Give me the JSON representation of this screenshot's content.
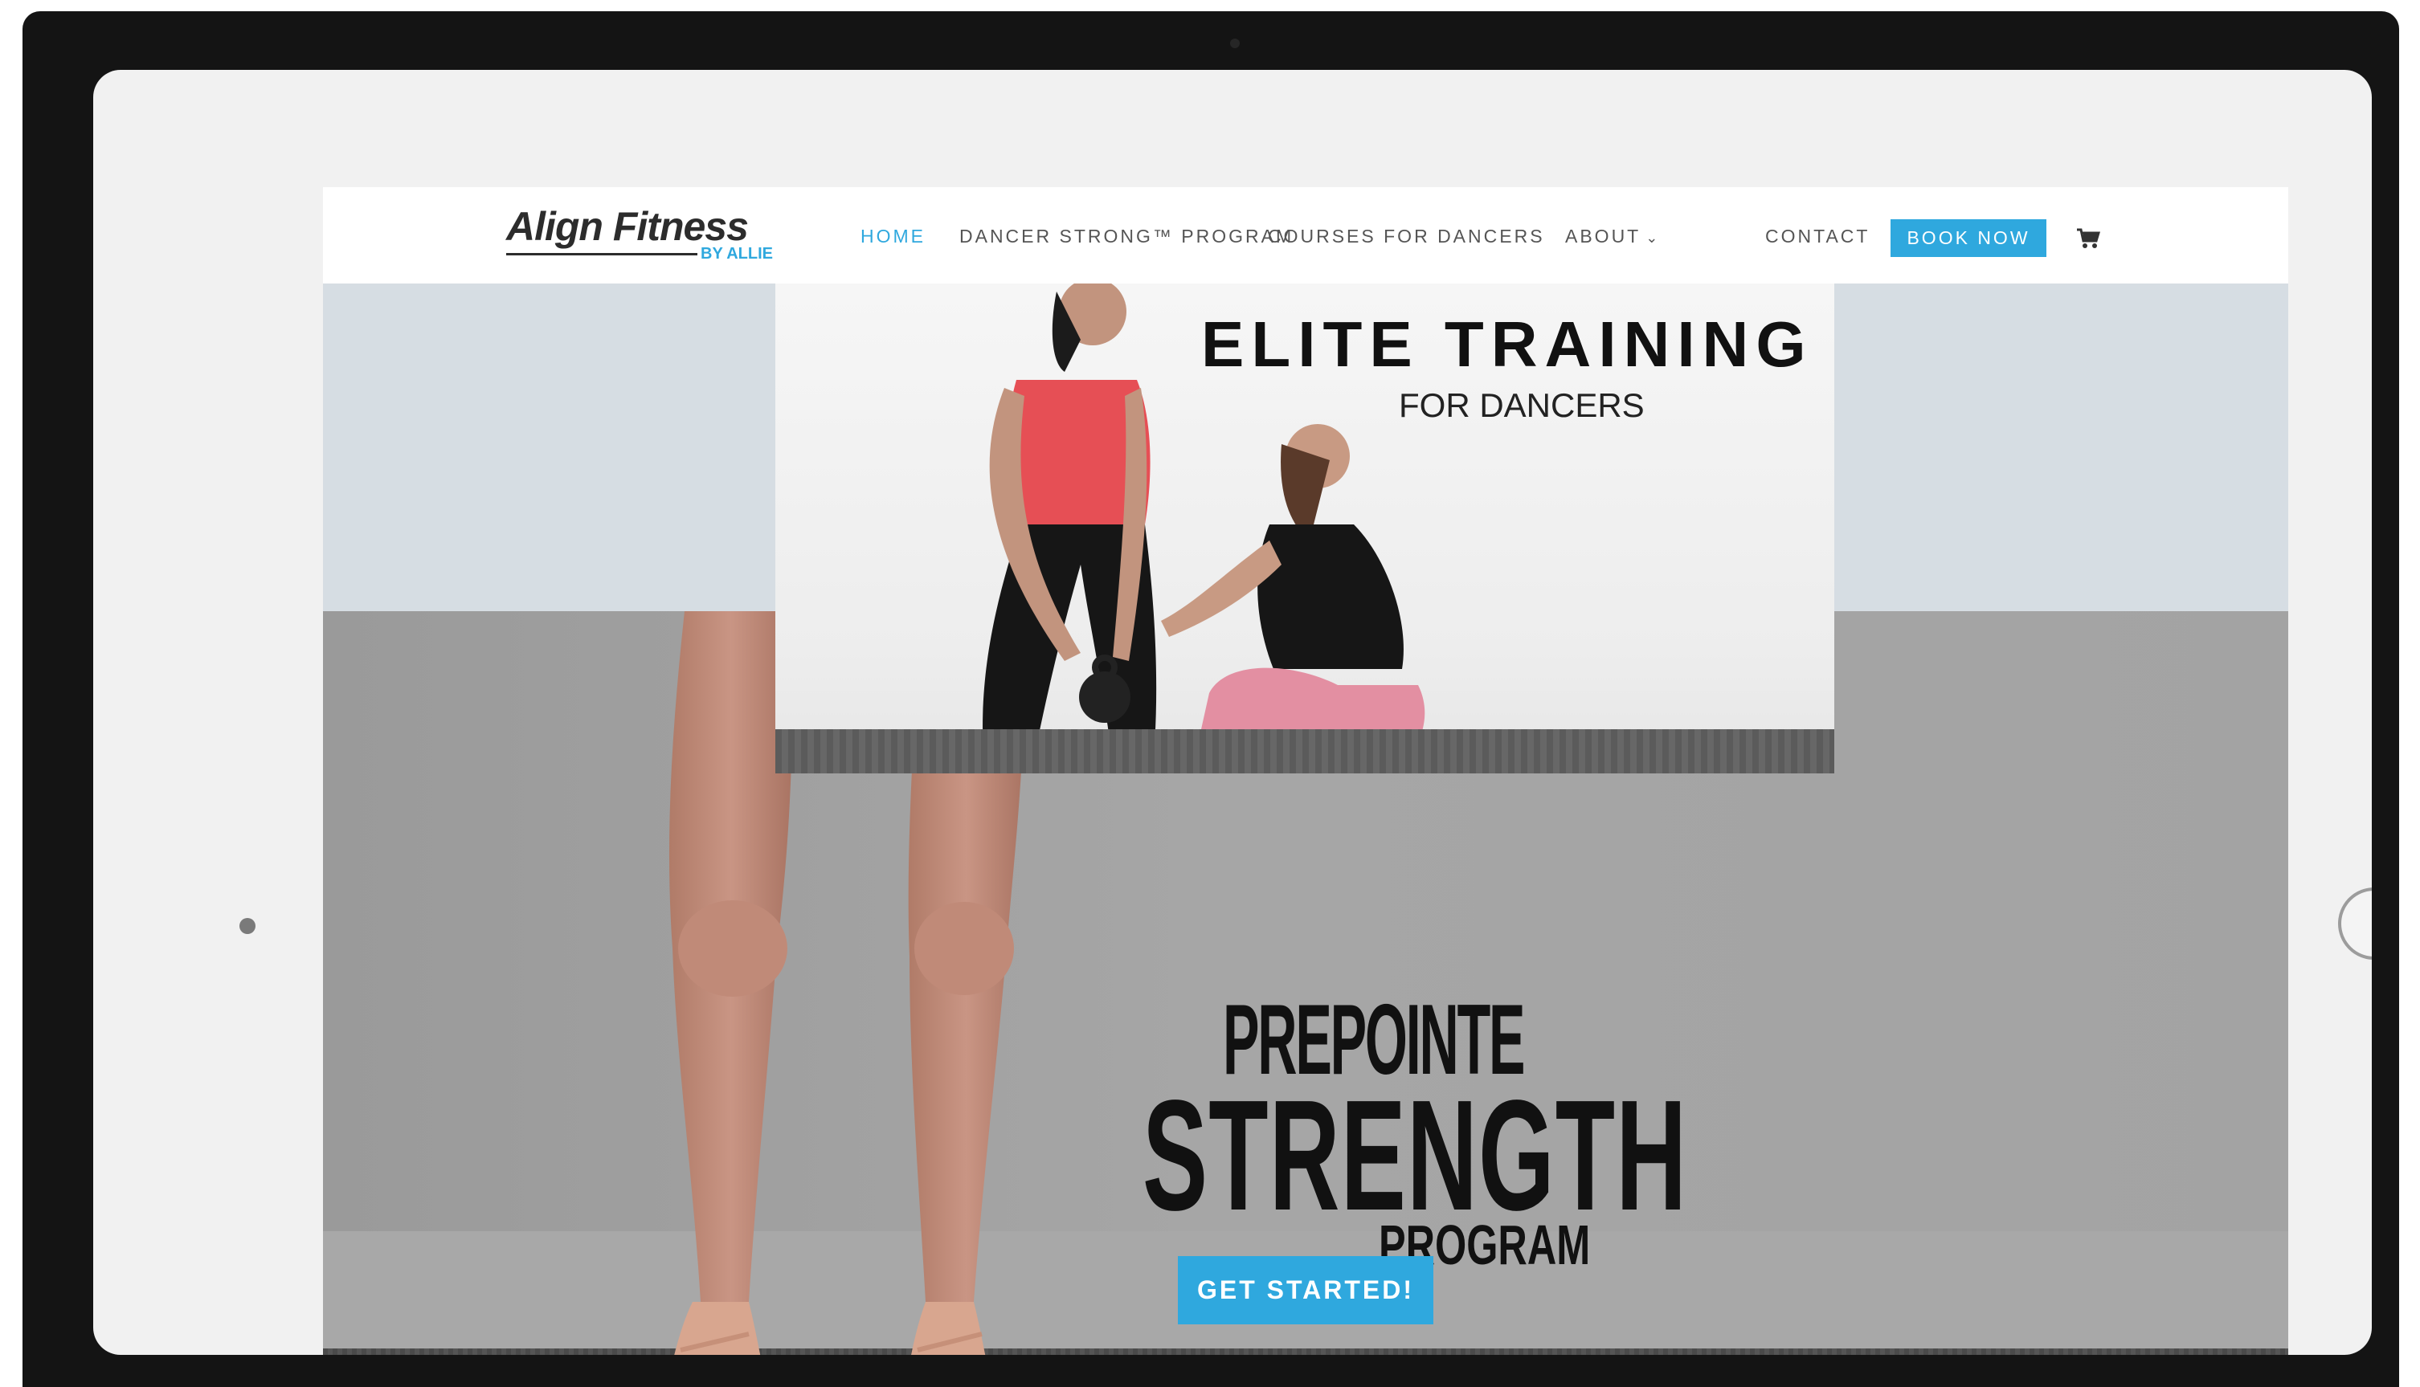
{
  "site": {
    "logo": {
      "main": "Align Fitness",
      "sub": "BY ALLIE"
    },
    "nav": [
      {
        "label": "HOME",
        "active": true
      },
      {
        "label": "DANCER STRONG™ PROGRAM"
      },
      {
        "label": "COURSES FOR DANCERS"
      },
      {
        "label": "ABOUT"
      },
      {
        "label": "CONTACT"
      }
    ],
    "book_now": "BOOK NOW",
    "cart_icon": "cart-icon",
    "about_icon": "chevron-down-icon"
  },
  "promo": {
    "title": "ELITE TRAINING",
    "subtitle": "FOR DANCERS"
  },
  "hero": {
    "line1": "PREPOINTE",
    "line2": "STRENGTH",
    "line3": "PROGRAM",
    "cta": "GET STARTED!"
  },
  "colors": {
    "accent": "#2fa8de",
    "bezel": "#141414",
    "nav_text": "#555555"
  }
}
